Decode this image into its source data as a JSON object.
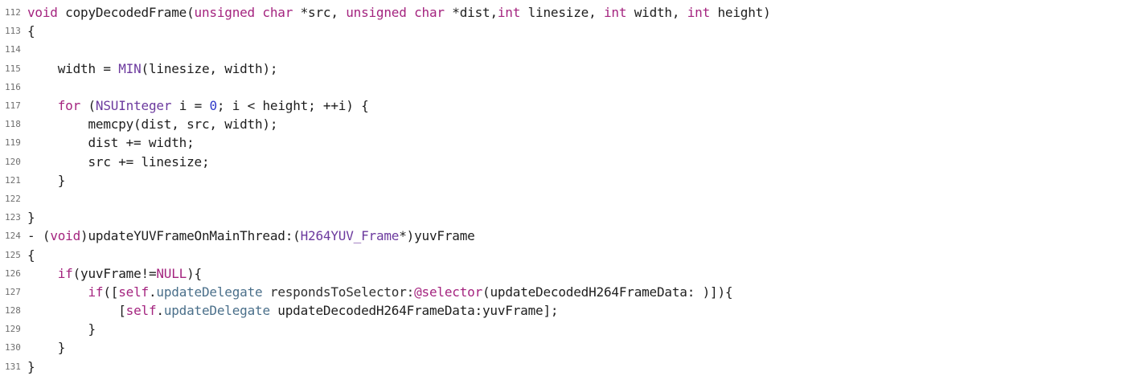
{
  "editor": {
    "lines": [
      {
        "number": "112",
        "tokens": [
          {
            "t": "void",
            "c": "kw"
          },
          {
            "t": " copyDecodedFrame(",
            "c": "pl"
          },
          {
            "t": "unsigned char",
            "c": "kw"
          },
          {
            "t": " *src, ",
            "c": "pl"
          },
          {
            "t": "unsigned char",
            "c": "kw"
          },
          {
            "t": " *dist,",
            "c": "pl"
          },
          {
            "t": "int",
            "c": "kw"
          },
          {
            "t": " linesize, ",
            "c": "pl"
          },
          {
            "t": "int",
            "c": "kw"
          },
          {
            "t": " width, ",
            "c": "pl"
          },
          {
            "t": "int",
            "c": "kw"
          },
          {
            "t": " height)",
            "c": "pl"
          }
        ]
      },
      {
        "number": "113",
        "tokens": [
          {
            "t": "{",
            "c": "pl"
          }
        ]
      },
      {
        "number": "114",
        "tokens": []
      },
      {
        "number": "115",
        "tokens": [
          {
            "t": "    width = ",
            "c": "pl"
          },
          {
            "t": "MIN",
            "c": "ty"
          },
          {
            "t": "(linesize, width);",
            "c": "pl"
          }
        ]
      },
      {
        "number": "116",
        "tokens": []
      },
      {
        "number": "117",
        "tokens": [
          {
            "t": "    ",
            "c": "pl"
          },
          {
            "t": "for",
            "c": "kw"
          },
          {
            "t": " (",
            "c": "pl"
          },
          {
            "t": "NSUInteger",
            "c": "ty"
          },
          {
            "t": " i = ",
            "c": "pl"
          },
          {
            "t": "0",
            "c": "num"
          },
          {
            "t": "; i < height; ++i) {",
            "c": "pl"
          }
        ]
      },
      {
        "number": "118",
        "tokens": [
          {
            "t": "        memcpy(dist, src, width);",
            "c": "pl"
          }
        ]
      },
      {
        "number": "119",
        "tokens": [
          {
            "t": "        dist += width;",
            "c": "pl"
          }
        ]
      },
      {
        "number": "120",
        "tokens": [
          {
            "t": "        src += linesize;",
            "c": "pl"
          }
        ]
      },
      {
        "number": "121",
        "tokens": [
          {
            "t": "    }",
            "c": "pl"
          }
        ]
      },
      {
        "number": "122",
        "tokens": []
      },
      {
        "number": "123",
        "tokens": [
          {
            "t": "}",
            "c": "pl"
          }
        ]
      },
      {
        "number": "124",
        "tokens": [
          {
            "t": "- (",
            "c": "pl"
          },
          {
            "t": "void",
            "c": "kw"
          },
          {
            "t": ")updateYUVFrameOnMainThread:(",
            "c": "pl"
          },
          {
            "t": "H264YUV_Frame",
            "c": "ty"
          },
          {
            "t": "*)yuvFrame",
            "c": "pl"
          }
        ]
      },
      {
        "number": "125",
        "tokens": [
          {
            "t": "{",
            "c": "pl"
          }
        ]
      },
      {
        "number": "126",
        "tokens": [
          {
            "t": "    ",
            "c": "pl"
          },
          {
            "t": "if",
            "c": "kw"
          },
          {
            "t": "(yuvFrame!=",
            "c": "pl"
          },
          {
            "t": "NULL",
            "c": "kw"
          },
          {
            "t": "){",
            "c": "pl"
          }
        ]
      },
      {
        "number": "127",
        "tokens": [
          {
            "t": "        ",
            "c": "pl"
          },
          {
            "t": "if",
            "c": "kw"
          },
          {
            "t": "([",
            "c": "pl"
          },
          {
            "t": "self",
            "c": "kw"
          },
          {
            "t": ".",
            "c": "pl"
          },
          {
            "t": "updateDelegate",
            "c": "prop"
          },
          {
            "t": " respondsToSelector:",
            "c": "sel"
          },
          {
            "t": "@selector",
            "c": "kw"
          },
          {
            "t": "(updateDecodedH264FrameData: )]){",
            "c": "pl"
          }
        ]
      },
      {
        "number": "128",
        "tokens": [
          {
            "t": "            [",
            "c": "pl"
          },
          {
            "t": "self",
            "c": "kw"
          },
          {
            "t": ".",
            "c": "pl"
          },
          {
            "t": "updateDelegate",
            "c": "prop"
          },
          {
            "t": " updateDecodedH264FrameData:yuvFrame];",
            "c": "pl"
          }
        ]
      },
      {
        "number": "129",
        "tokens": [
          {
            "t": "        }",
            "c": "pl"
          }
        ]
      },
      {
        "number": "130",
        "tokens": [
          {
            "t": "    }",
            "c": "pl"
          }
        ]
      },
      {
        "number": "131",
        "tokens": [
          {
            "t": "}",
            "c": "pl"
          }
        ]
      }
    ]
  }
}
